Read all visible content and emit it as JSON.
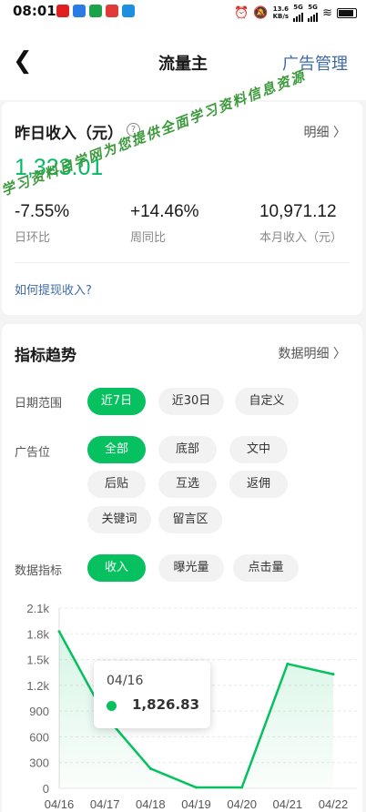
{
  "status_bar": {
    "time": "08:01",
    "net_speed_value": "13.6",
    "net_speed_unit": "KB/s",
    "sim1": "5G",
    "sim2": "5G"
  },
  "nav": {
    "back_icon": "chevron-left-icon",
    "title": "流量主",
    "right_label": "广告管理"
  },
  "income_card": {
    "title": "昨日收入（元）",
    "help_icon": "?",
    "detail_label": "明细 〉",
    "yesterday_income": "1,323.01",
    "stats": [
      {
        "value": "-7.55%",
        "label": "日环比"
      },
      {
        "value": "+14.46%",
        "label": "周同比"
      },
      {
        "value": "10,971.12",
        "label": "本月收入（元）"
      }
    ],
    "how_link": "如何提现收入?"
  },
  "watermark": "学习资料自学网为您提供全面学习资料信息资源",
  "trend_card": {
    "title": "指标趋势",
    "detail_label": "数据明细 〉",
    "date_range": {
      "label": "日期范围",
      "options": [
        "近7日",
        "近30日",
        "自定义"
      ],
      "selected": "近7日"
    },
    "ad_position": {
      "label": "广告位",
      "options": [
        "全部",
        "底部",
        "文中",
        "后贴",
        "互选",
        "返佣",
        "关键词",
        "留言区"
      ],
      "selected": "全部"
    },
    "metric": {
      "label": "数据指标",
      "options": [
        "收入",
        "曝光量",
        "点击量"
      ],
      "selected": "收入"
    }
  },
  "tooltip": {
    "date": "04/16",
    "value": "1,826.83"
  },
  "colors": {
    "accent": "#07c160",
    "income_green": "#07b966",
    "link_blue": "#3f6aa8"
  },
  "chart_data": {
    "type": "area",
    "x": [
      "04/16",
      "04/17",
      "04/18",
      "04/19",
      "04/20",
      "04/21",
      "04/22"
    ],
    "values": [
      1826.83,
      850,
      230,
      10,
      10,
      1450,
      1330
    ],
    "ylim": [
      0,
      2100
    ],
    "yticks": [
      0,
      300,
      600,
      900,
      1200,
      1500,
      1800,
      2100
    ],
    "ytick_labels": [
      "0",
      "300",
      "600",
      "900",
      "1.2k",
      "1.5k",
      "1.8k",
      "2.1k"
    ],
    "grid": true
  }
}
